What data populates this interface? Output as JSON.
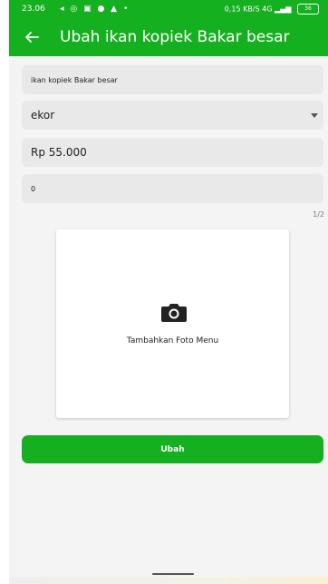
{
  "status_bar": {
    "time": "23.06",
    "left_icons": [
      "navigation-icon",
      "whatsapp-icon",
      "shop-icon",
      "chat-icon",
      "gallery-icon",
      "dot-icon"
    ],
    "network_speed": "0,15 KB/S",
    "signal_text": "4G",
    "battery": "36"
  },
  "app_bar": {
    "title": "Ubah ikan kopiek Bakar besar",
    "back_icon": "arrow-left-icon"
  },
  "form": {
    "name_value": "ikan kopiek Bakar besar",
    "unit_value": "ekor",
    "price_value": "Rp 55.000",
    "stock_value": "0",
    "counter": "1/2"
  },
  "photo": {
    "label": "Tambahkan Foto Menu",
    "icon": "camera-icon"
  },
  "submit_label": "Ubah",
  "colors": {
    "primary": "#15b01f",
    "field_bg": "#e9e9e9",
    "page_bg": "#f4f4f4"
  }
}
